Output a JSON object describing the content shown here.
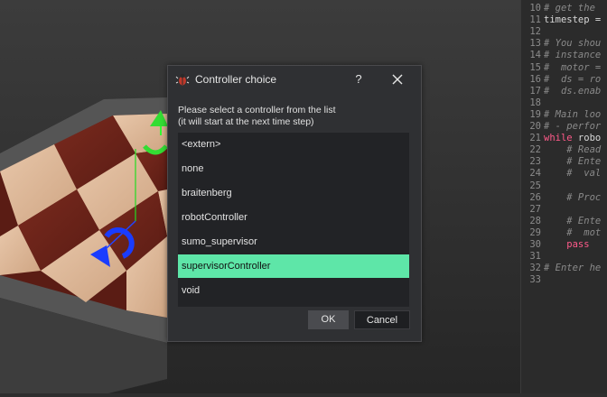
{
  "dialog": {
    "title": "Controller choice",
    "help_label": "?",
    "prompt_line1": "Please select a controller from the list",
    "prompt_line2": "(it will start at the next time step)",
    "items": [
      {
        "label": "<extern>",
        "selected": false
      },
      {
        "label": "none",
        "selected": false
      },
      {
        "label": "braitenberg",
        "selected": false
      },
      {
        "label": "robotController",
        "selected": false
      },
      {
        "label": "sumo_supervisor",
        "selected": false
      },
      {
        "label": "supervisorController",
        "selected": true
      },
      {
        "label": "void",
        "selected": false
      }
    ],
    "ok_label": "OK",
    "cancel_label": "Cancel",
    "selection_color": "#5ee6a8"
  },
  "editor": {
    "lines": [
      {
        "num": "10",
        "text": "# get the"
      },
      {
        "num": "11",
        "text": "timestep ="
      },
      {
        "num": "12",
        "text": ""
      },
      {
        "num": "13",
        "text": "# You shou"
      },
      {
        "num": "14",
        "text": "# instance"
      },
      {
        "num": "15",
        "text": "#  motor ="
      },
      {
        "num": "16",
        "text": "#  ds = ro"
      },
      {
        "num": "17",
        "text": "#  ds.enab"
      },
      {
        "num": "18",
        "text": ""
      },
      {
        "num": "19",
        "text": "# Main loo"
      },
      {
        "num": "20",
        "text": "# - perfor"
      },
      {
        "num": "21",
        "kw": "while",
        "text": " robo"
      },
      {
        "num": "22",
        "text": "    # Read"
      },
      {
        "num": "23",
        "text": "    # Ente"
      },
      {
        "num": "24",
        "text": "    #  val"
      },
      {
        "num": "25",
        "text": ""
      },
      {
        "num": "26",
        "text": "    # Proc"
      },
      {
        "num": "27",
        "text": ""
      },
      {
        "num": "28",
        "text": "    # Ente"
      },
      {
        "num": "29",
        "text": "    #  mot"
      },
      {
        "num": "30",
        "text": "    pass"
      },
      {
        "num": "31",
        "text": ""
      },
      {
        "num": "32",
        "text": "# Enter he"
      },
      {
        "num": "33",
        "text": ""
      }
    ]
  }
}
